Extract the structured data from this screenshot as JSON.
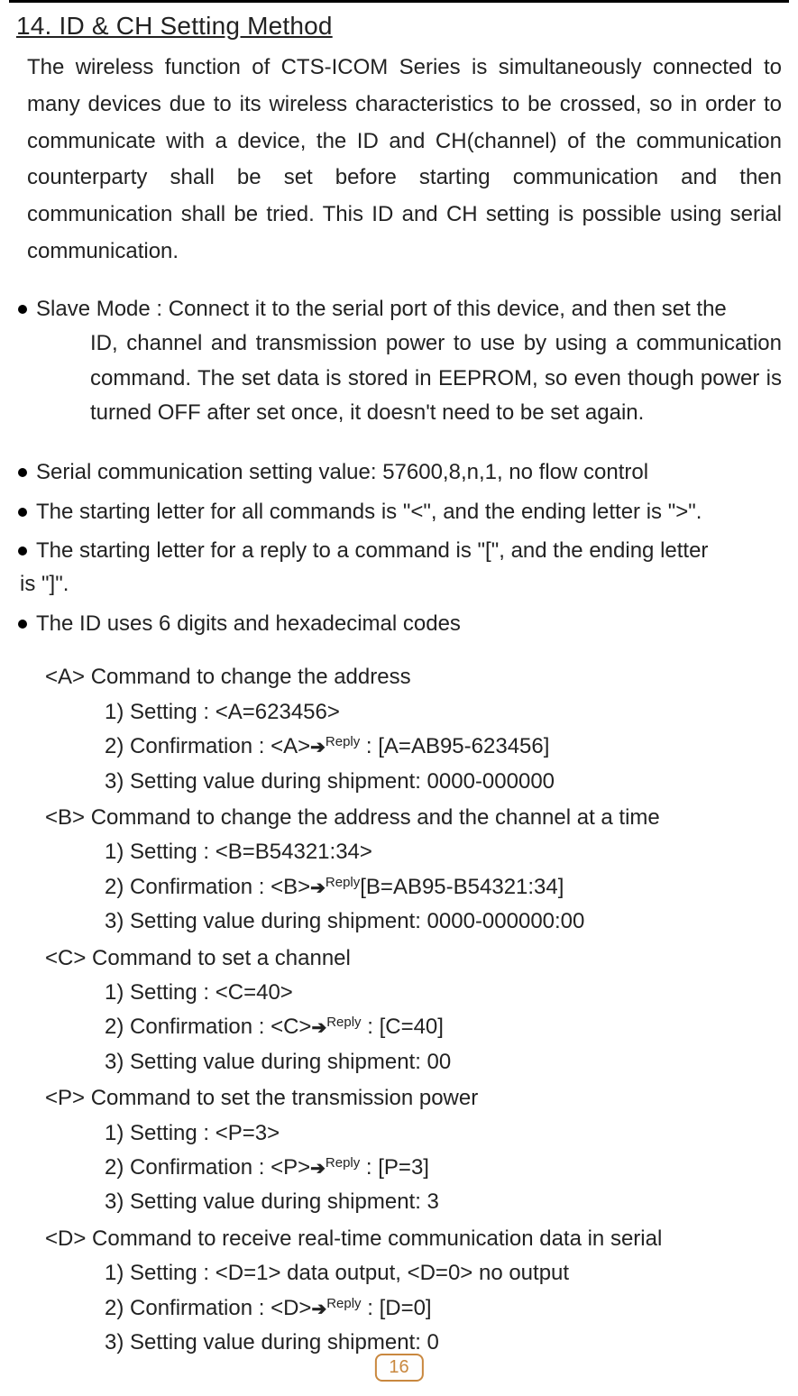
{
  "title": "14. ID & CH Setting Method",
  "intro": "The wireless function of CTS-ICOM Series is simultaneously connected to many devices due to its wireless characteristics to be crossed, so in order to communicate with a device, the ID and CH(channel) of the communication counterparty shall be set before starting communication and then communication shall be tried. This ID and CH setting is possible using serial communication.",
  "slave": {
    "lead": "Slave Mode : Connect it to the serial port of this device, and then set the",
    "detail": "ID, channel and transmission power to use by using a communication command. The set data is stored in EEPROM, so even though power is turned OFF after set once, it doesn't need to be set again."
  },
  "bullets": {
    "b1": "Serial communication setting value: 57600,8,n,1, no flow control",
    "b2": "The starting letter for all commands is \"<\", and the ending letter is \">\".",
    "b3_a": "The starting letter for a reply to a command is \"[\", and the ending letter",
    "b3_b": "is \"]\".",
    "b4": "The ID uses 6 digits and hexadecimal codes"
  },
  "commands": [
    {
      "title": "<A> Command to change the address",
      "items": [
        {
          "n": "1)",
          "pre": "Setting : <A=623456>"
        },
        {
          "n": "2)",
          "pre": "Confirmation : <A>",
          "arrow": "➔",
          "sup": "Reply",
          "post": " : [A=AB95-623456]"
        },
        {
          "n": "3)",
          "pre": "Setting value during shipment: 0000-000000"
        }
      ]
    },
    {
      "title": "<B> Command to change the address and the channel at a time",
      "items": [
        {
          "n": "1)",
          "pre": "Setting : <B=B54321:34>"
        },
        {
          "n": "2)",
          "pre": "Confirmation : <B>",
          "arrow": "➔",
          "sup": "Reply",
          "post": "[B=AB95-B54321:34]"
        },
        {
          "n": "3)",
          "pre": "Setting value during shipment: 0000-000000:00"
        }
      ]
    },
    {
      "title": "<C> Command to set a channel",
      "items": [
        {
          "n": "1)",
          "pre": "Setting : <C=40>"
        },
        {
          "n": "2)",
          "pre": "Confirmation : <C>",
          "arrow": "➔",
          "sup": "Reply",
          "post": " : [C=40]"
        },
        {
          "n": "3)",
          "pre": "Setting value during shipment: 00"
        }
      ]
    },
    {
      "title": "<P> Command to set the transmission power",
      "items": [
        {
          "n": "1)",
          "pre": "Setting : <P=3>"
        },
        {
          "n": "2)",
          "pre": "Confirmation : <P>",
          "arrow": "➔",
          "sup": "Reply",
          "post": " : [P=3]"
        },
        {
          "n": "3)",
          "pre": "Setting value during shipment: 3"
        }
      ]
    },
    {
      "title": "<D> Command to receive real-time communication data in serial",
      "items": [
        {
          "n": "1)",
          "pre": "Setting : <D=1> data output, <D=0> no output"
        },
        {
          "n": "2)",
          "pre": "Confirmation : <D>",
          "arrow": "➔",
          "sup": "Reply",
          "post": " : [D=0]"
        },
        {
          "n": "3)",
          "pre": "Setting value during shipment: 0"
        }
      ]
    }
  ],
  "page_number": "16"
}
